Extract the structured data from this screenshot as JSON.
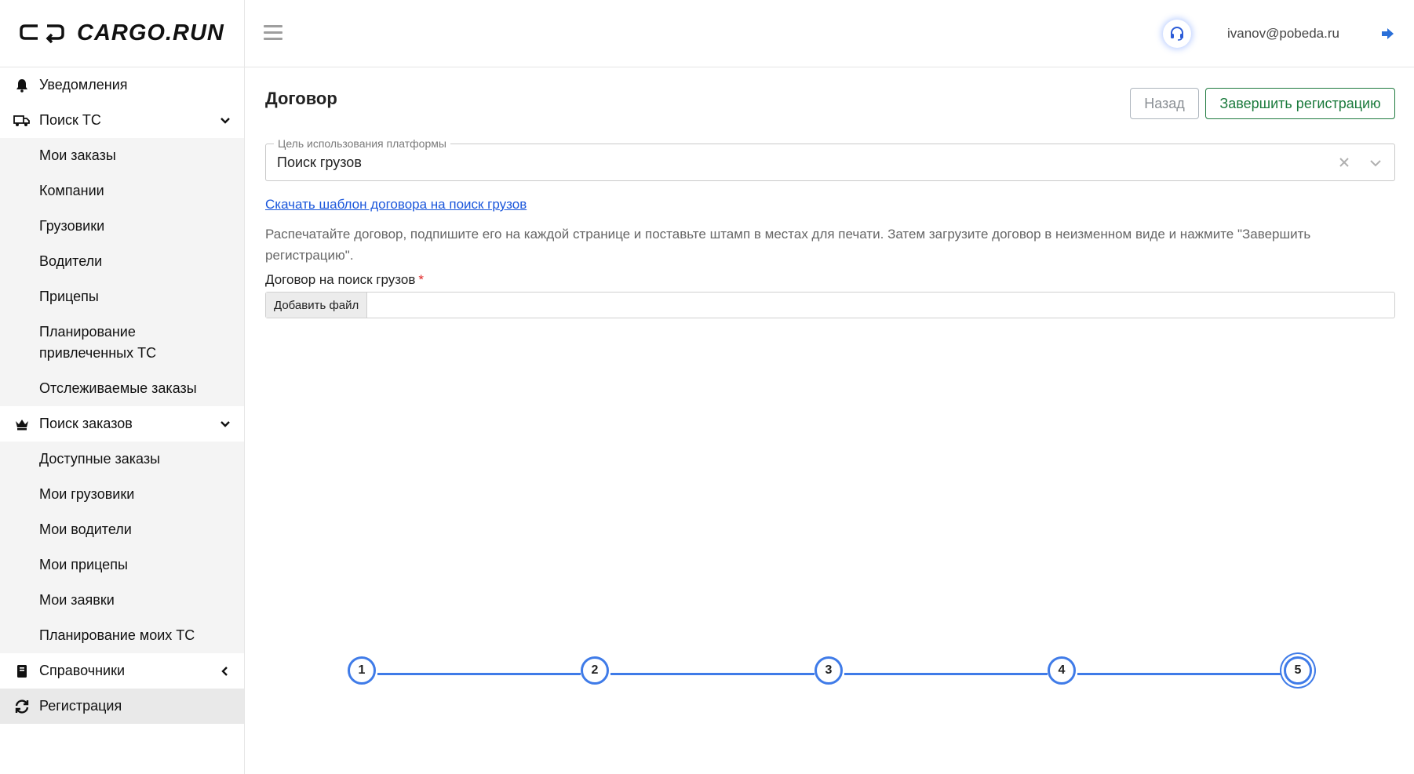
{
  "brand": {
    "name": "CARGO.RUN"
  },
  "header": {
    "user_email": "ivanov@pobeda.ru",
    "support_icon": "headset-icon",
    "logout_icon": "sign-out-icon"
  },
  "sidebar": {
    "items": [
      {
        "label": "Уведомления",
        "icon": "bell-icon"
      },
      {
        "label": "Поиск ТС",
        "icon": "truck-icon",
        "expanded": true,
        "children": [
          "Мои заказы",
          "Компании",
          "Грузовики",
          "Водители",
          "Прицепы",
          "Планирование привлеченных ТС",
          "Отслеживаемые заказы"
        ]
      },
      {
        "label": "Поиск заказов",
        "icon": "crown-icon",
        "expanded": true,
        "children": [
          "Доступные заказы",
          "Мои грузовики",
          "Мои водители",
          "Мои прицепы",
          "Мои заявки",
          "Планирование моих ТС"
        ]
      },
      {
        "label": "Справочники",
        "icon": "book-icon",
        "expanded": false
      },
      {
        "label": "Регистрация",
        "icon": "sync-icon",
        "active": true
      }
    ]
  },
  "main": {
    "title": "Договор",
    "back_label": "Назад",
    "finish_label": "Завершить регистрацию",
    "purpose": {
      "legend": "Цель использования платформы",
      "value": "Поиск грузов"
    },
    "download_link": "Скачать шаблон договора на поиск грузов",
    "instructions": "Распечатайте договор, подпишите его на каждой странице и поставьте штамп в местах для печати. Затем загрузите договор в неизменном виде и нажмите \"Завершить регистрацию\".",
    "file_label": "Договор на поиск грузов",
    "required_mark": "*",
    "file_button": "Добавить файл"
  },
  "stepper": {
    "steps": [
      "1",
      "2",
      "3",
      "4",
      "5"
    ],
    "current": 5
  },
  "colors": {
    "accent": "#3f7be8",
    "success": "#1a7a3c",
    "link": "#1a56db",
    "required": "#e02424"
  }
}
